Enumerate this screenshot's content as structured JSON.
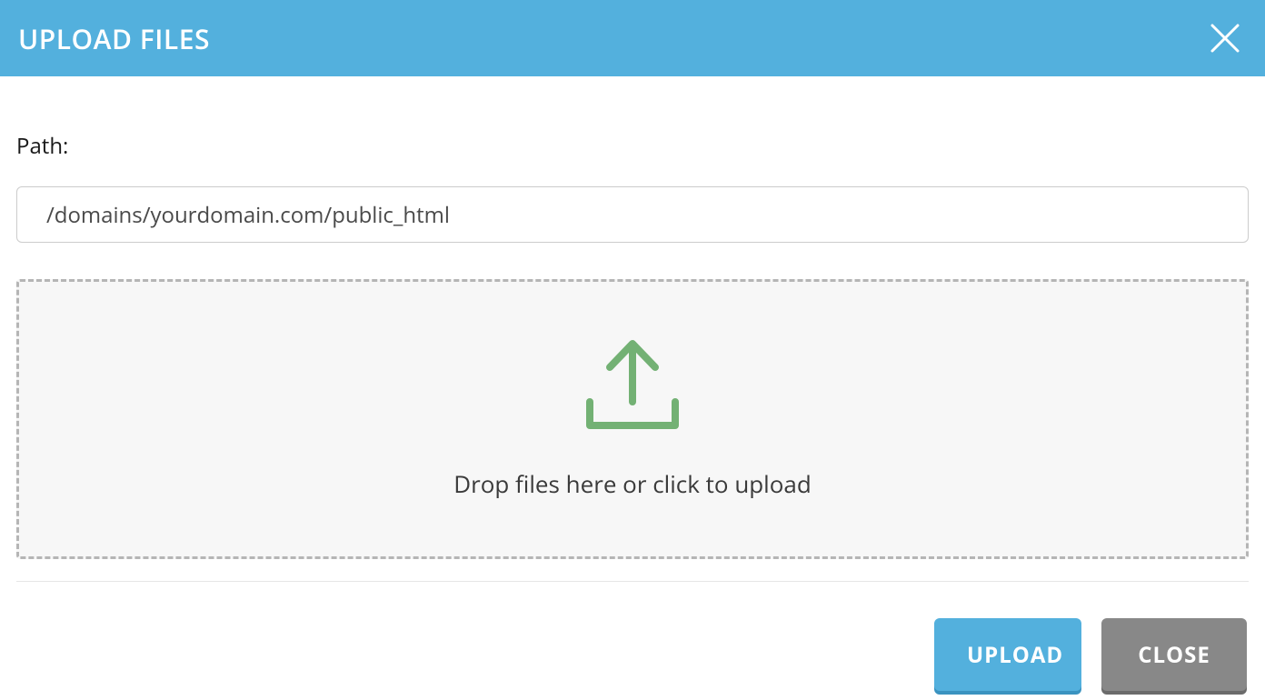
{
  "header": {
    "title": "UPLOAD FILES"
  },
  "form": {
    "path_label": "Path:",
    "path_value": "/domains/yourdomain.com/public_html"
  },
  "dropzone": {
    "instruction": "Drop files here or click to upload"
  },
  "buttons": {
    "upload_label": "UPLOAD",
    "close_label": "CLOSE"
  },
  "icons": {
    "close": "close-icon",
    "upload": "upload-arrow-icon"
  },
  "colors": {
    "accent": "#53b0dd",
    "accent_shadow": "#3a93c0",
    "neutral": "#888888",
    "neutral_shadow": "#6b6b6b",
    "upload_icon": "#73b174",
    "border_dashed": "#b5b5b5",
    "dropzone_bg": "#f7f7f7"
  }
}
